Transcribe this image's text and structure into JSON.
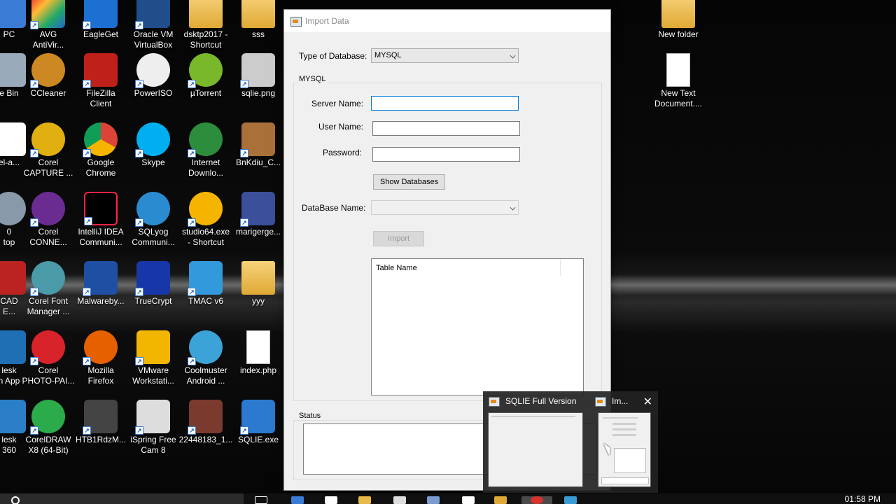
{
  "desktop": {
    "icons": [
      {
        "label": "PC",
        "name": "this-pc"
      },
      {
        "label": "AVG\nAntiVir...",
        "name": "avg"
      },
      {
        "label": "EagleGet",
        "name": "eagleget"
      },
      {
        "label": "Oracle VM\nVirtualBox",
        "name": "virtualbox"
      },
      {
        "label": "dsktp2017 -\nShortcut",
        "name": "dsktp2017"
      },
      {
        "label": "sss",
        "name": "sss"
      },
      {
        "label": "e Bin",
        "name": "recycle-bin"
      },
      {
        "label": "CCleaner",
        "name": "ccleaner"
      },
      {
        "label": "FileZilla\nClient",
        "name": "filezilla"
      },
      {
        "label": "PowerISO",
        "name": "poweriso"
      },
      {
        "label": "µTorrent",
        "name": "utorrent"
      },
      {
        "label": "sqlie.png",
        "name": "sqlie-png"
      },
      {
        "label": "el-a...",
        "name": "el-a"
      },
      {
        "label": "Corel\nCAPTURE ...",
        "name": "corel-capture"
      },
      {
        "label": "Google\nChrome",
        "name": "chrome"
      },
      {
        "label": "Skype",
        "name": "skype"
      },
      {
        "label": "Internet\nDownlo...",
        "name": "idm"
      },
      {
        "label": "BnKdiu_C...",
        "name": "bnkdiu"
      },
      {
        "label": "0\ntop",
        "name": "top"
      },
      {
        "label": "Corel\nCONNE...",
        "name": "corel-connect"
      },
      {
        "label": "IntelliJ IDEA\nCommuni...",
        "name": "intellij"
      },
      {
        "label": "SQLyog\nCommuni...",
        "name": "sqlyog"
      },
      {
        "label": "studio64.exe\n- Shortcut",
        "name": "studio64"
      },
      {
        "label": "marigerge...",
        "name": "marigerge"
      },
      {
        "label": "CAD\nE...",
        "name": "cad"
      },
      {
        "label": "Corel Font\nManager ...",
        "name": "corel-font"
      },
      {
        "label": "Malwareby...",
        "name": "malwarebytes"
      },
      {
        "label": "TrueCrypt",
        "name": "truecrypt"
      },
      {
        "label": "TMAC v6",
        "name": "tmac"
      },
      {
        "label": "yyy",
        "name": "yyy"
      },
      {
        "label": "lesk\nn App",
        "name": "autodesk-app"
      },
      {
        "label": "Corel\nPHOTO-PAI...",
        "name": "corel-photo"
      },
      {
        "label": "Mozilla\nFirefox",
        "name": "firefox"
      },
      {
        "label": "VMware\nWorkstati...",
        "name": "vmware"
      },
      {
        "label": "Coolmuster\nAndroid ...",
        "name": "coolmuster"
      },
      {
        "label": "index.php",
        "name": "index-php"
      },
      {
        "label": "lesk\n360",
        "name": "autodesk-360"
      },
      {
        "label": "CorelDRAW\nX8 (64-Bit)",
        "name": "coreldraw"
      },
      {
        "label": "HTB1RdzM...",
        "name": "htb1rdzm"
      },
      {
        "label": "iSpring Free\nCam 8",
        "name": "ispring"
      },
      {
        "label": "22448183_1...",
        "name": "img-22448183"
      },
      {
        "label": "SQLIE.exe",
        "name": "sqlie-exe"
      },
      {
        "label": "New folder",
        "name": "new-folder"
      },
      {
        "label": "New Text\nDocument....",
        "name": "new-text-doc"
      }
    ]
  },
  "dialog": {
    "title": "Import Data",
    "db_type_label": "Type of Database:",
    "db_type_value": "MYSQL",
    "group_title": "MYSQL",
    "server_label": "Server Name:",
    "user_label": "User Name:",
    "password_label": "Password:",
    "show_db_button": "Show Databases",
    "dbname_label": "DataBase Name:",
    "dbname_value": "",
    "import_button": "Import",
    "table_col_header": "Table Name",
    "status_title": "Status"
  },
  "thumbnails": [
    {
      "title": "SQLIE Full Version"
    },
    {
      "title": "Im..."
    }
  ],
  "taskbar": {
    "clock": "01:58 PM"
  }
}
